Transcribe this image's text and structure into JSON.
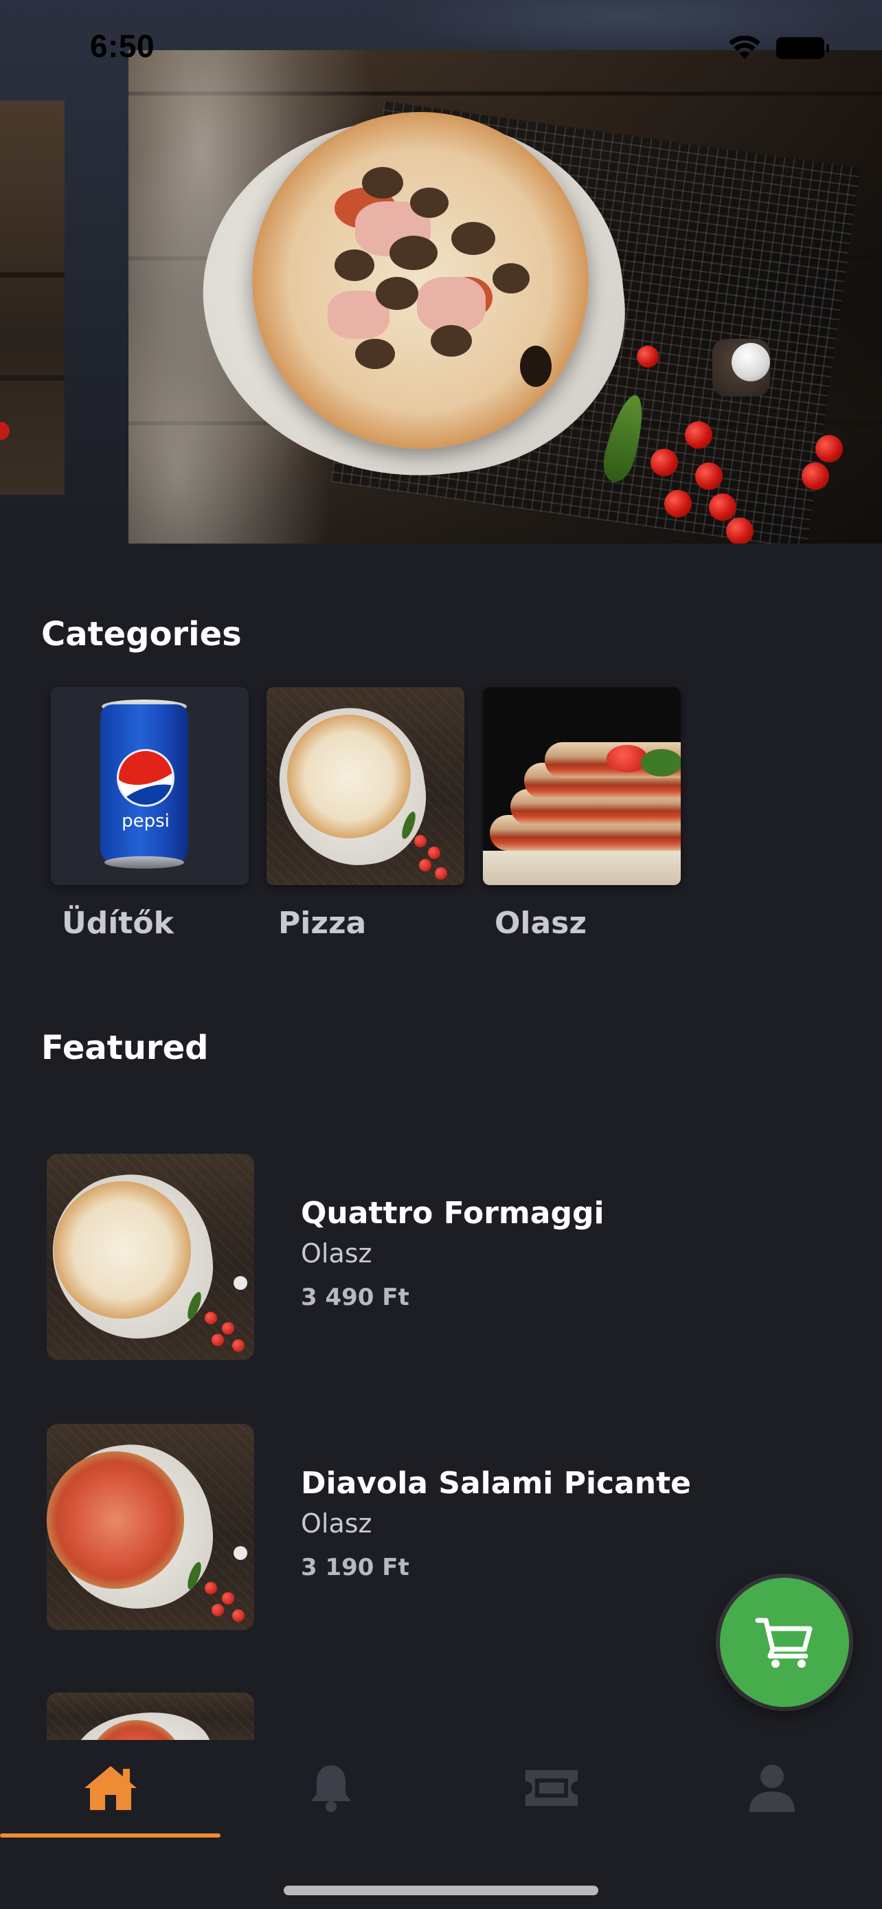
{
  "status_bar": {
    "time": "6:50",
    "icons": [
      "wifi-icon",
      "battery-icon"
    ]
  },
  "hero": {
    "images": [
      "side-image-previous",
      "pizza-mushroom-ham-hero"
    ]
  },
  "categories": {
    "title": "Categories",
    "items": [
      {
        "label": "Üdítők",
        "image": "pepsi-can"
      },
      {
        "label": "Pizza",
        "image": "white-pizza"
      },
      {
        "label": "Olasz",
        "image": "stacked-slices"
      }
    ]
  },
  "featured": {
    "title": "Featured",
    "items": [
      {
        "name": "Quattro Formaggi",
        "category": "Olasz",
        "price": "3 490 Ft"
      },
      {
        "name": "Diavola Salami Picante",
        "category": "Olasz",
        "price": "3 190 Ft"
      }
    ]
  },
  "can_brand": "pepsi",
  "fab": {
    "icon": "cart-icon",
    "color": "#47ac4b"
  },
  "bottom_nav": {
    "items": [
      "home-icon",
      "bell-icon",
      "ticket-icon",
      "user-icon"
    ],
    "active_index": 0,
    "active_color": "#f08b35",
    "inactive_color": "#3e4049"
  }
}
